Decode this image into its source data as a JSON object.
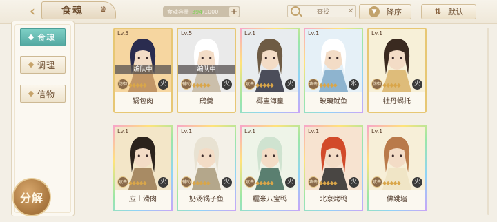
{
  "header": {
    "back_label": "‹",
    "title": "食魂",
    "capacity_label": "食魂容量",
    "capacity_current": "394",
    "capacity_max": "/1000",
    "search_placeholder": "查找",
    "sort_desc_label": "降序",
    "sort_default_label": "默认"
  },
  "sidebar": {
    "tabs": [
      {
        "label": "食魂",
        "active": true
      },
      {
        "label": "调理",
        "active": false
      },
      {
        "label": "信物",
        "active": false
      }
    ],
    "decompose_label": "分解"
  },
  "cards": [
    {
      "level": "Lv.5",
      "name": "锅包肉",
      "status": "编队中",
      "class": "防御",
      "stars": "◆◆◆◆◆",
      "badge": "火",
      "colors": [
        "#f6d6a0",
        "#2a2c4f",
        "#b98b5c"
      ]
    },
    {
      "level": "Lv.5",
      "name": "鸱羹",
      "status": "编队中",
      "class": "辅助",
      "stars": "◆◆◆◆◆",
      "badge": "火",
      "colors": [
        "#eaeaea",
        "#ffffff",
        "#c6b7a0"
      ]
    },
    {
      "level": "Lv.1",
      "name": "椰盅海皇",
      "status": "",
      "class": "攻击",
      "stars": "◆◆◆◆◆",
      "badge": "火",
      "colors": [
        "#e8ecef",
        "#6e5b44",
        "#2f3140"
      ]
    },
    {
      "level": "Lv.1",
      "name": "玻璃鱿鱼",
      "status": "",
      "class": "攻击",
      "stars": "◆◆◆◆◆",
      "badge": "水",
      "colors": [
        "#e5f0f7",
        "#ffffff",
        "#7fa9c8"
      ]
    },
    {
      "level": "Lv.1",
      "name": "牡丹蝎托",
      "status": "",
      "class": "防御",
      "stars": "◆◆◆◆◆",
      "badge": "火",
      "colors": [
        "#f7f0d8",
        "#3a2a20",
        "#d9b36a"
      ]
    },
    {
      "level": "Lv.1",
      "name": "应山滑肉",
      "status": "",
      "class": "攻击",
      "stars": "◆◆◆◆◆",
      "badge": "火",
      "colors": [
        "#f3e6c8",
        "#2b231c",
        "#9a7a52"
      ]
    },
    {
      "level": "Lv.1",
      "name": "奶汤锅子鱼",
      "status": "",
      "class": "辅助",
      "stars": "◆◆◆◆◆",
      "badge": "火",
      "colors": [
        "#f4f1e8",
        "#e8e2d2",
        "#a89a7a"
      ]
    },
    {
      "level": "Lv.1",
      "name": "糯米八宝鸭",
      "status": "",
      "class": "攻击",
      "stars": "◆◆◆◆◆",
      "badge": "火",
      "colors": [
        "#eef4e8",
        "#cfe3d0",
        "#3f6a5a"
      ]
    },
    {
      "level": "Lv.1",
      "name": "北京烤鸭",
      "status": "",
      "class": "攻击",
      "stars": "◆◆◆◆◆",
      "badge": "火",
      "colors": [
        "#f7e3d0",
        "#d24a2a",
        "#2a2a2a"
      ]
    },
    {
      "level": "Lv.1",
      "name": "佛跳墙",
      "status": "",
      "class": "攻击",
      "stars": "◆◆◆◆◆",
      "badge": "火",
      "colors": [
        "#f7efd8",
        "#b97a4a",
        "#efe3c3"
      ]
    }
  ]
}
